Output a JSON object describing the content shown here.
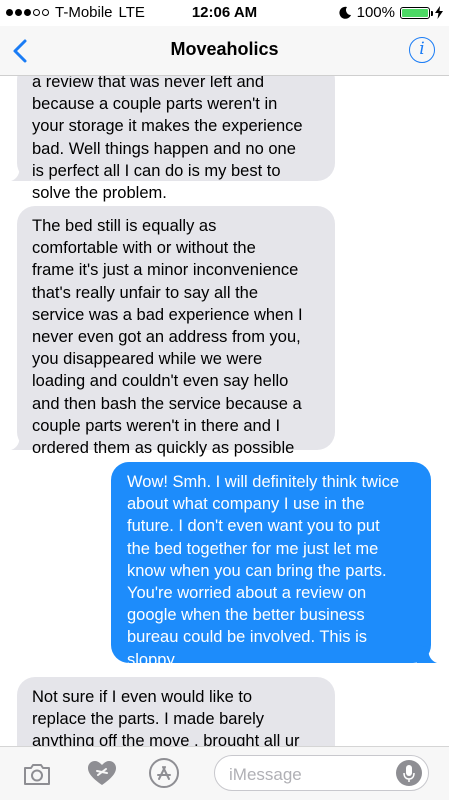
{
  "status_bar": {
    "carrier": "T-Mobile",
    "network": "LTE",
    "time": "12:06 AM",
    "battery": "100%",
    "signal_bars_filled": 3,
    "signal_bars_total": 5
  },
  "header": {
    "title": "Moveaholics",
    "back_icon": "chevron-left-icon",
    "info_icon_text": "i"
  },
  "messages": [
    {
      "direction": "incoming",
      "lines": [
        "a review that was never left and",
        "because a couple parts weren't in",
        "your storage it makes the experience",
        "bad.  Well things happen and no one",
        "is perfect all I can do is my best to",
        "solve the problem."
      ]
    },
    {
      "direction": "incoming",
      "lines": [
        "The bed still is equally as",
        "comfortable with or without the",
        "frame it's just a minor inconvenience",
        "that's really unfair to say all the",
        "service was a bad experience when I",
        "never even got an address from you,",
        "you disappeared while we were",
        "loading and couldn't even say hello",
        "and then bash the service because a",
        "couple parts weren't in there and I",
        "ordered them as quickly as possible"
      ]
    },
    {
      "direction": "outgoing",
      "lines": [
        "Wow! Smh. I will definitely think twice",
        "about what company I use in the",
        "future. I don't even want you to put",
        "the bed together for me just let me",
        "know when you can bring the parts.",
        "You're worried about a review on",
        "google when the better business",
        "bureau could be involved. This is",
        "sloppy."
      ]
    },
    {
      "direction": "incoming",
      "lines": [
        "Not sure if I even would like to",
        "replace the parts.  I made barely",
        "anything off the move , brought all ur"
      ]
    }
  ],
  "input_bar": {
    "placeholder": "iMessage",
    "camera_icon": "camera-icon",
    "digital_touch_icon": "digital-touch-heart-icon",
    "app_store_icon": "app-store-icon",
    "mic_icon": "microphone-icon"
  },
  "colors": {
    "accent": "#1a7cf5",
    "incoming_bubble": "#e5e5ea",
    "outgoing_bubble": "#1d8cfb",
    "battery": "#4cd964"
  }
}
